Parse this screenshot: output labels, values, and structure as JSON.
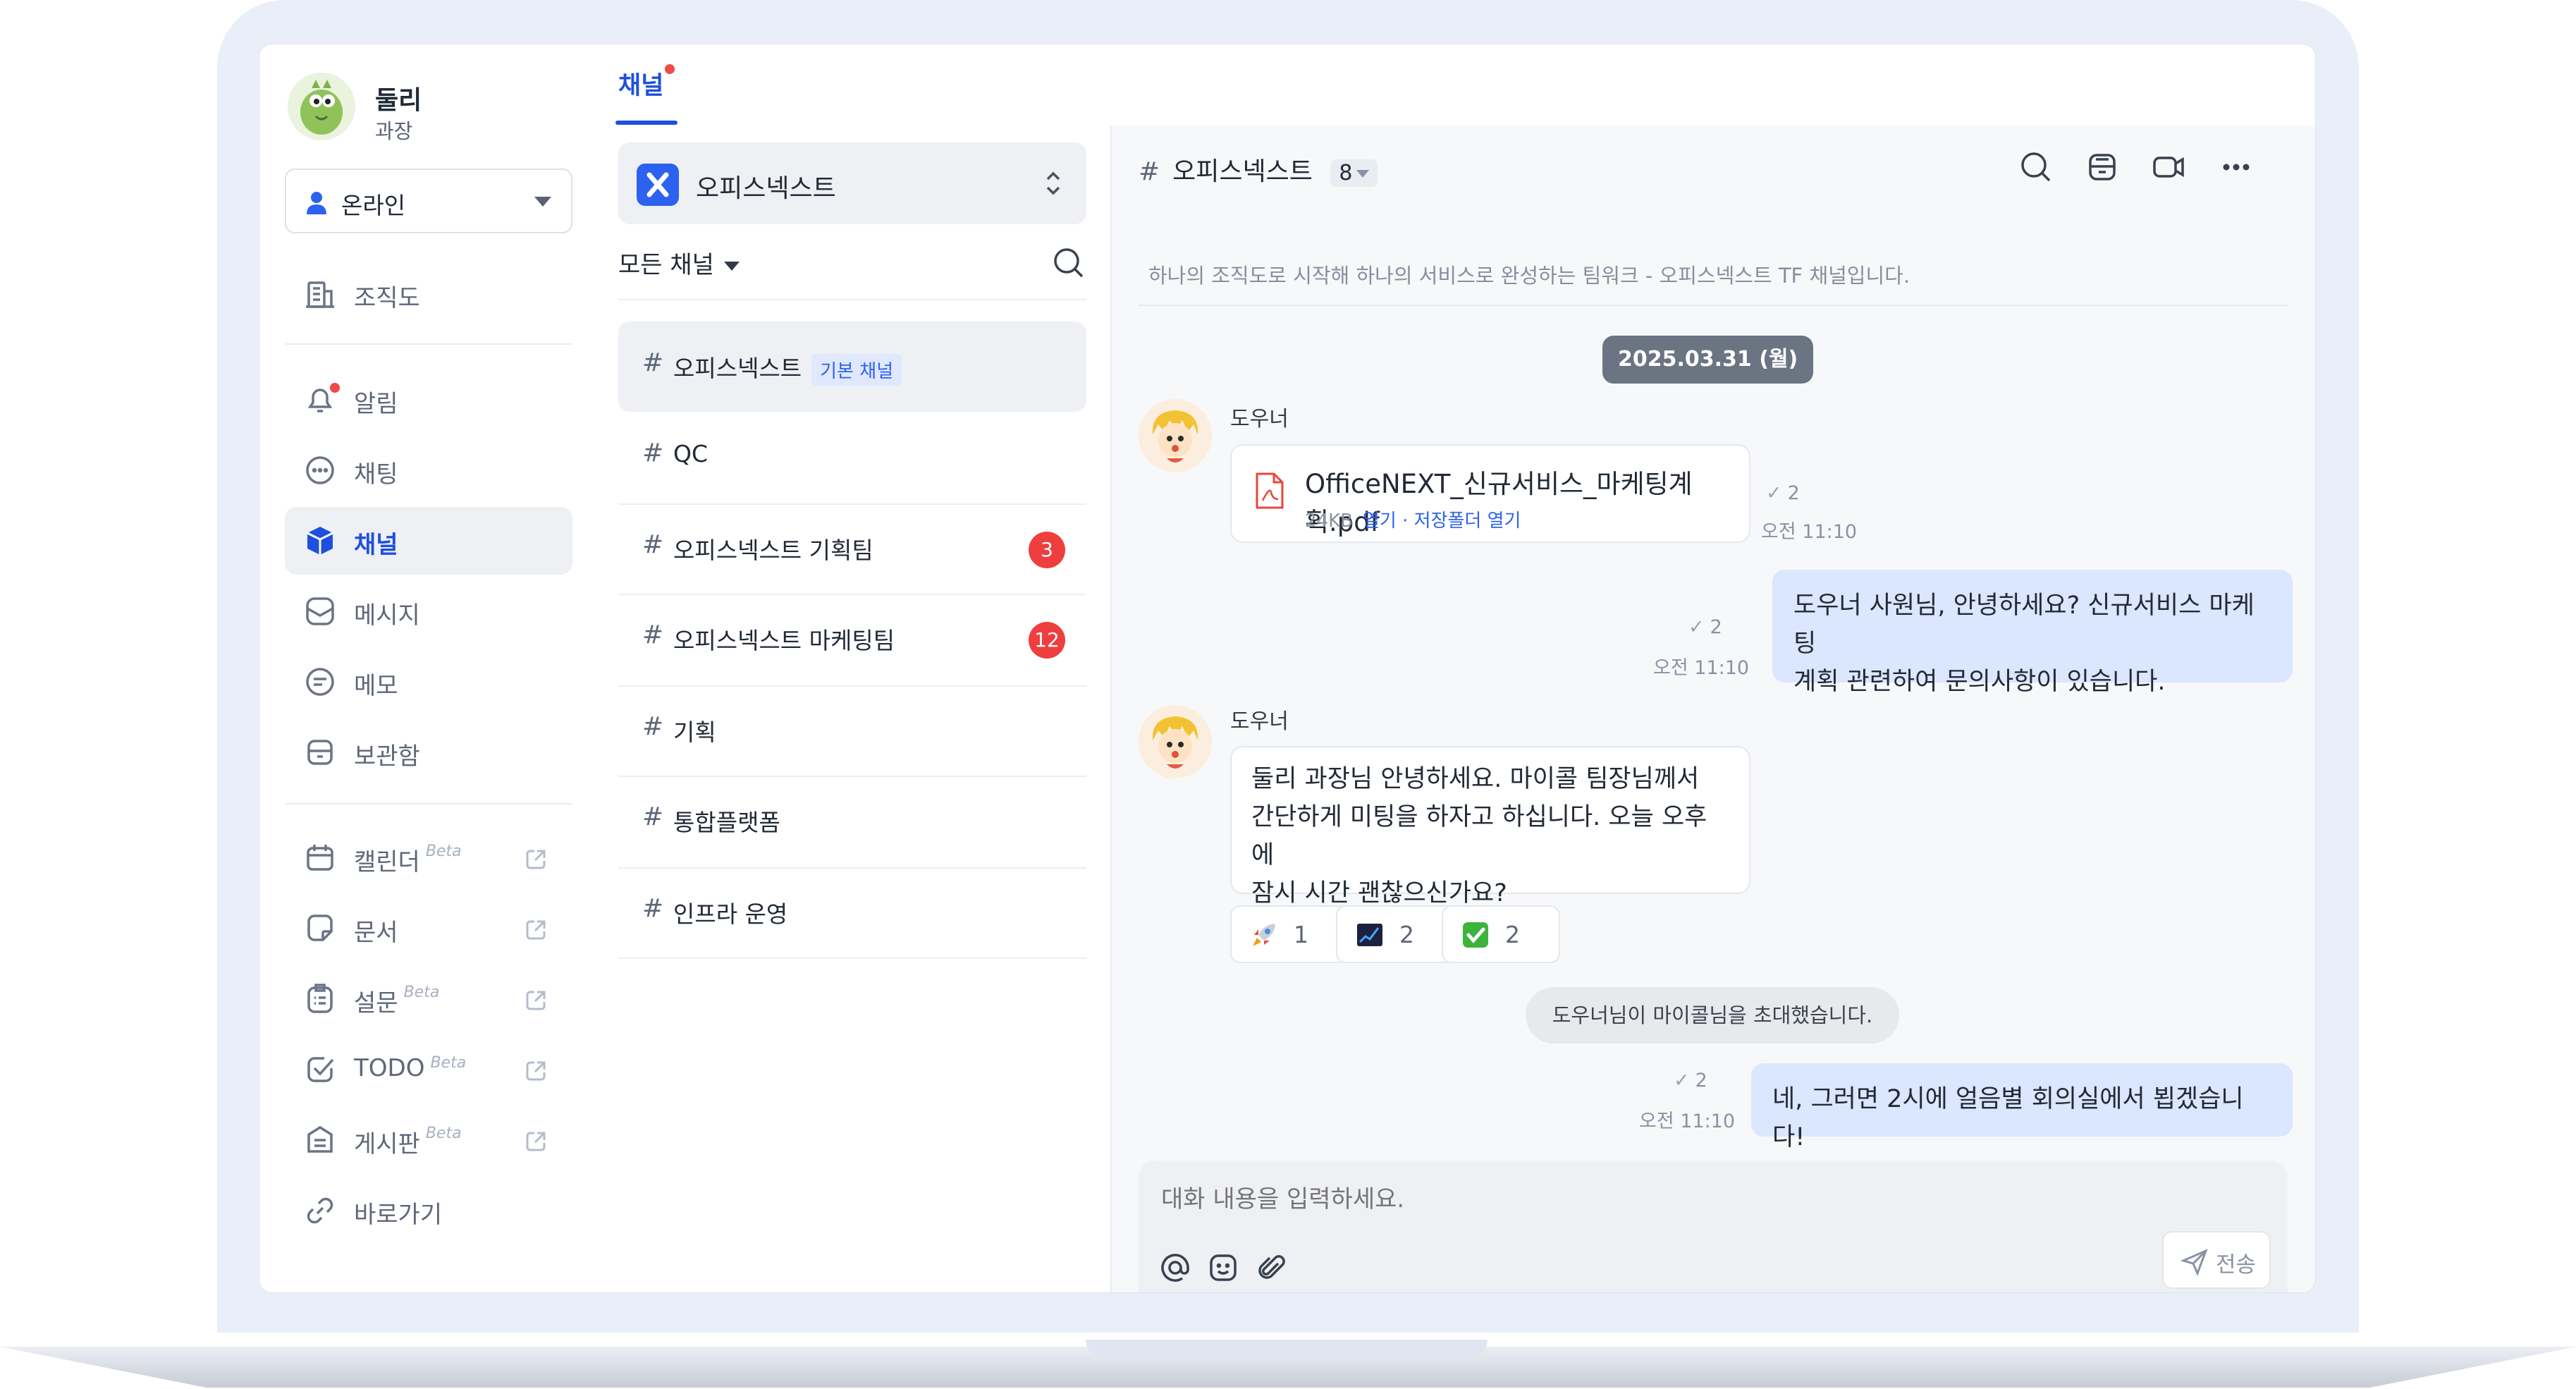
{
  "user": {
    "name": "둘리",
    "title": "과장"
  },
  "status": {
    "value": "온라인"
  },
  "nav": {
    "org_chart": "조직도",
    "alerts": "알림",
    "chatting": "채팅",
    "channel": "채널",
    "message": "메시지",
    "memo": "메모",
    "archive": "보관함",
    "calendar": "캘린더",
    "docs": "문서",
    "survey": "설문",
    "todo": "TODO",
    "board": "게시판",
    "shortcut": "바로가기",
    "beta": "Beta"
  },
  "tabs": {
    "channel": "채널"
  },
  "workspace": {
    "name": "오피스넥스트"
  },
  "channel_filter": "모든 채널",
  "channels": [
    {
      "hash": "#",
      "name": "오피스넥스트",
      "tag": "기본 채널",
      "badge": ""
    },
    {
      "hash": "#",
      "name": "QC",
      "tag": "",
      "badge": ""
    },
    {
      "hash": "#",
      "name": "오피스넥스트 기획팀",
      "tag": "",
      "badge": "3"
    },
    {
      "hash": "#",
      "name": "오피스넥스트 마케팅팀",
      "tag": "",
      "badge": "12"
    },
    {
      "hash": "#",
      "name": "기획",
      "tag": "",
      "badge": ""
    },
    {
      "hash": "#",
      "name": "통합플랫폼",
      "tag": "",
      "badge": ""
    },
    {
      "hash": "#",
      "name": "인프라 운영",
      "tag": "",
      "badge": ""
    }
  ],
  "chat": {
    "hash": "#",
    "title": "오피스넥스트",
    "member_count": "8",
    "description": "하나의 조직도로 시작해 하나의 서비스로 완성하는 팀워크 - 오피스넥스트 TF 채널입니다.",
    "date": "2025.03.31 (월)",
    "messages": [
      {
        "sender": "도우너",
        "file_name": "OfficeNEXT_신규서비스_마케팅계획.pdf",
        "file_size": "24KB",
        "file_actions": "열기 · 저장폴더 열기",
        "read_count": "2",
        "time": "오전 11:10"
      },
      {
        "line1": "도우너 사원님, 안녕하세요? 신규서비스 마케팅",
        "line2": "계획 관련하여 문의사항이 있습니다.",
        "read_count": "2",
        "time": "오전 11:10"
      },
      {
        "sender": "도우너",
        "line1": "둘리 과장님 안녕하세요. 마이콜 팀장님께서",
        "line2": "간단하게 미팅을 하자고 하십니다. 오늘 오후에",
        "line3": "잠시 시간 괜찮으신가요?"
      },
      {
        "line1": "네, 그러면 2시에 얼음별 회의실에서 뵙겠습니다!",
        "read_count": "2",
        "time": "오전 11:10"
      }
    ],
    "reactions": [
      {
        "emoji": "rocket-icon",
        "count": "1"
      },
      {
        "emoji": "chart-icon",
        "count": "2"
      },
      {
        "emoji": "check-icon",
        "count": "2"
      }
    ],
    "system_message": "도우너님이 마이콜님을 초대했습니다.",
    "composer_placeholder": "대화 내용을 입력하세요.",
    "send_label": "전송"
  },
  "colors": {
    "accent": "#2D62F0",
    "badge": "#EF3E3E",
    "bubble_mine": "#DBE6FF"
  }
}
